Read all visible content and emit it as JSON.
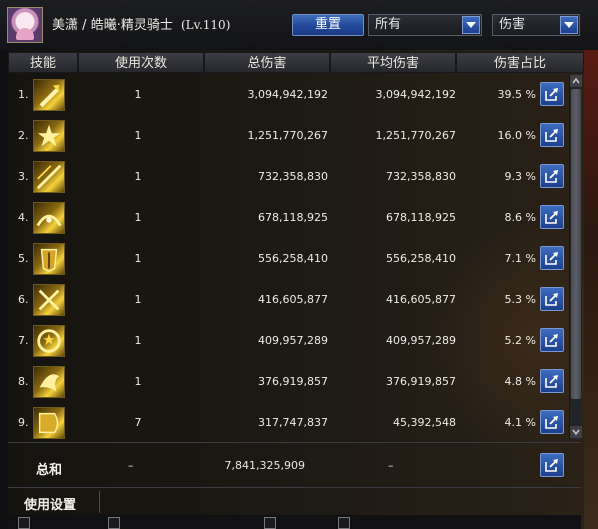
{
  "header": {
    "player_name": "美潇",
    "separator": "/",
    "job": "皓曦·精灵骑士",
    "level": "(Lv.110)",
    "reset_label": "重置",
    "filter_value": "所有",
    "type_value": "伤害"
  },
  "columns": [
    "技能",
    "使用次数",
    "总伤害",
    "平均伤害",
    "伤害占比"
  ],
  "rows": [
    {
      "index": "1.",
      "uses": "1",
      "total": "3,094,942,192",
      "avg": "3,094,942,192",
      "pct": "39.5 %",
      "icon": "skill-icon-1"
    },
    {
      "index": "2.",
      "uses": "1",
      "total": "1,251,770,267",
      "avg": "1,251,770,267",
      "pct": "16.0 %",
      "icon": "skill-icon-2"
    },
    {
      "index": "3.",
      "uses": "1",
      "total": "732,358,830",
      "avg": "732,358,830",
      "pct": "9.3 %",
      "icon": "skill-icon-3"
    },
    {
      "index": "4.",
      "uses": "1",
      "total": "678,118,925",
      "avg": "678,118,925",
      "pct": "8.6 %",
      "icon": "skill-icon-4"
    },
    {
      "index": "5.",
      "uses": "1",
      "total": "556,258,410",
      "avg": "556,258,410",
      "pct": "7.1 %",
      "icon": "skill-icon-5"
    },
    {
      "index": "6.",
      "uses": "1",
      "total": "416,605,877",
      "avg": "416,605,877",
      "pct": "5.3 %",
      "icon": "skill-icon-6"
    },
    {
      "index": "7.",
      "uses": "1",
      "total": "409,957,289",
      "avg": "409,957,289",
      "pct": "5.2 %",
      "icon": "skill-icon-7"
    },
    {
      "index": "8.",
      "uses": "1",
      "total": "376,919,857",
      "avg": "376,919,857",
      "pct": "4.8 %",
      "icon": "skill-icon-8"
    },
    {
      "index": "9.",
      "uses": "7",
      "total": "317,747,837",
      "avg": "45,392,548",
      "pct": "4.1 %",
      "icon": "skill-icon-9"
    }
  ],
  "summary": {
    "label": "总和",
    "uses": "–",
    "total": "7,841,325,909",
    "avg": "–"
  },
  "settings": {
    "label": "使用设置"
  },
  "colors": {
    "accent_blue": "#2a56a8",
    "icon_gold": "#f5d13a",
    "background": "#1a1814"
  }
}
